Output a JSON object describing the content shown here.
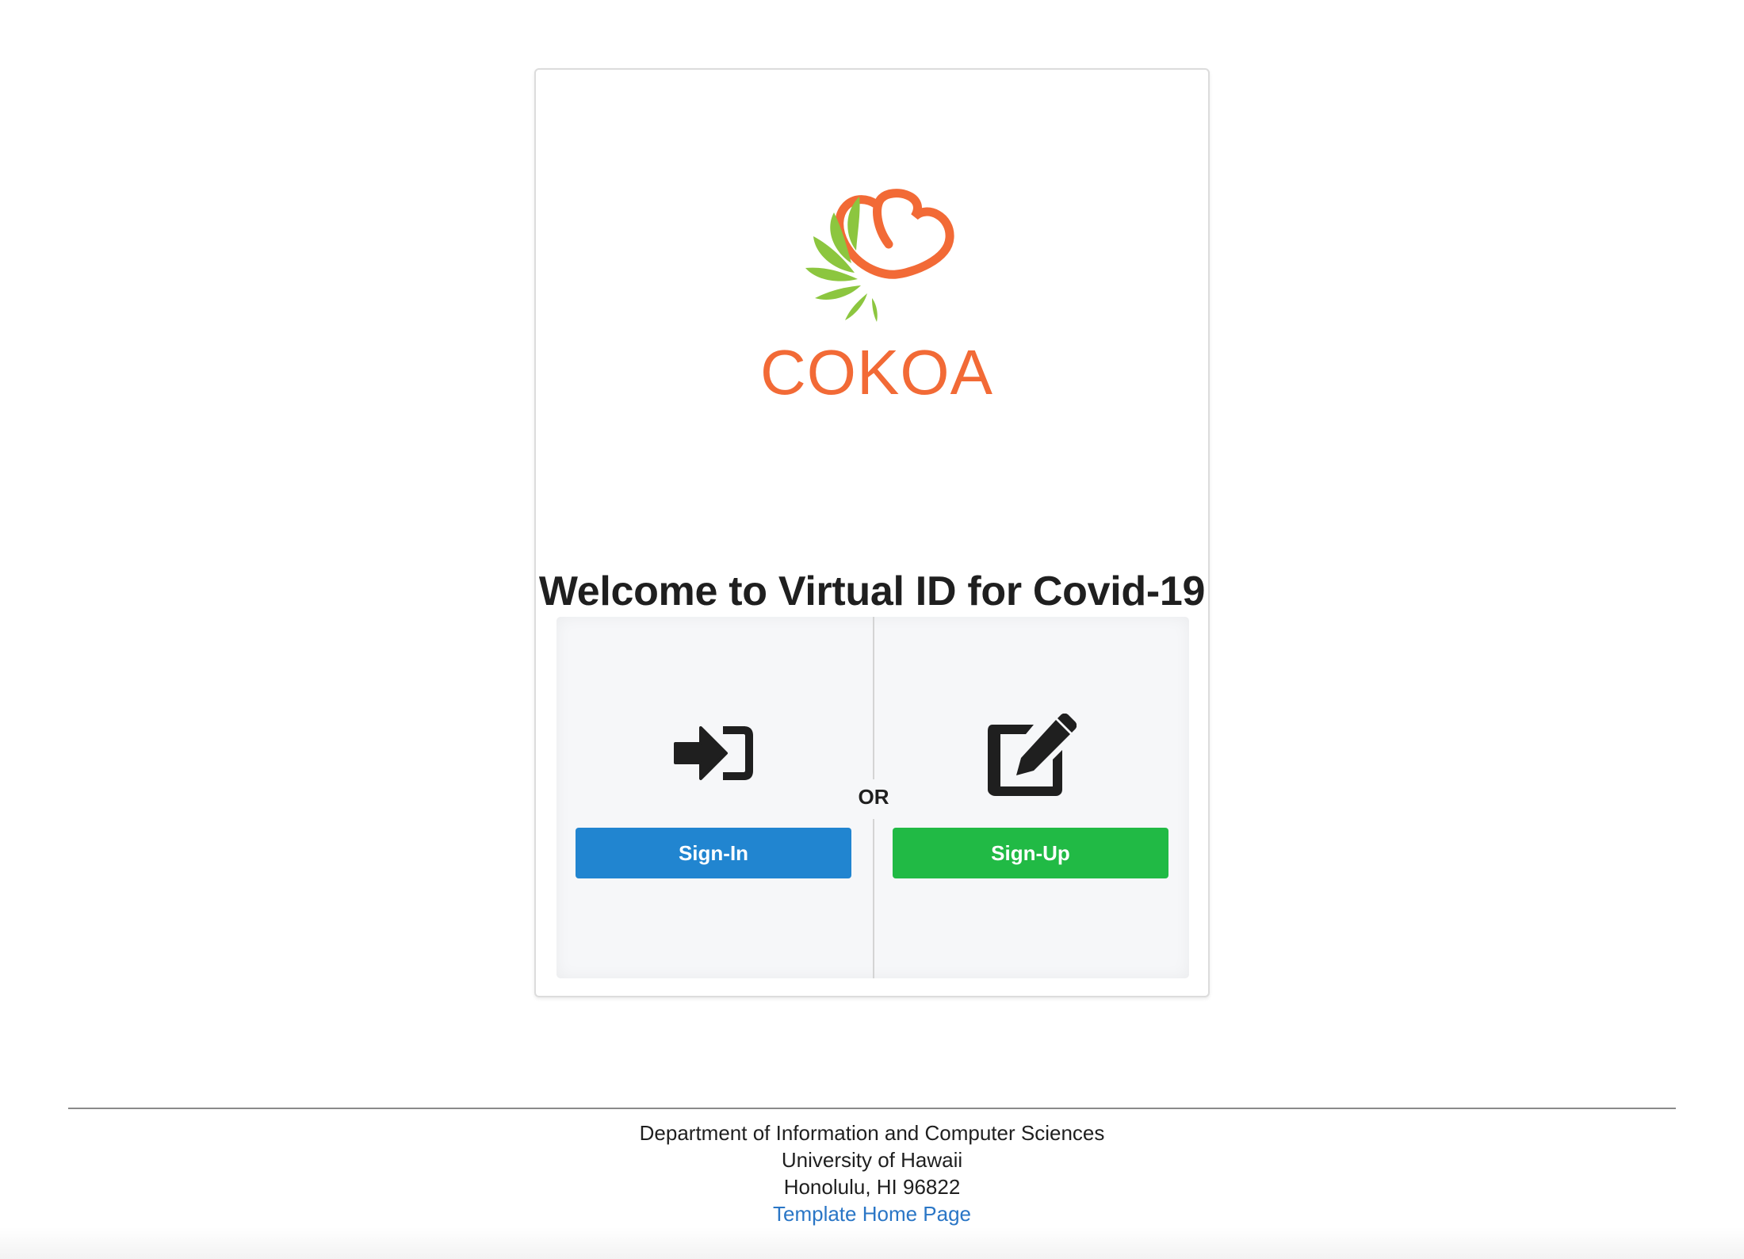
{
  "brand": {
    "name": "COKOA",
    "colors": {
      "orange": "#f26a36",
      "green": "#8cc63f"
    }
  },
  "welcome": {
    "title": "Welcome to Virtual ID for Covid-19"
  },
  "auth": {
    "signin_icon": "sign-in-icon",
    "signup_icon": "edit-icon",
    "or_label": "OR",
    "signin_label": "Sign-In",
    "signup_label": "Sign-Up",
    "signin_color": "#2185d0",
    "signup_color": "#21ba45"
  },
  "footer": {
    "line1": "Department of Information and Computer Sciences",
    "line2": "University of Hawaii",
    "line3": "Honolulu, HI 96822",
    "link_label": "Template Home Page"
  }
}
